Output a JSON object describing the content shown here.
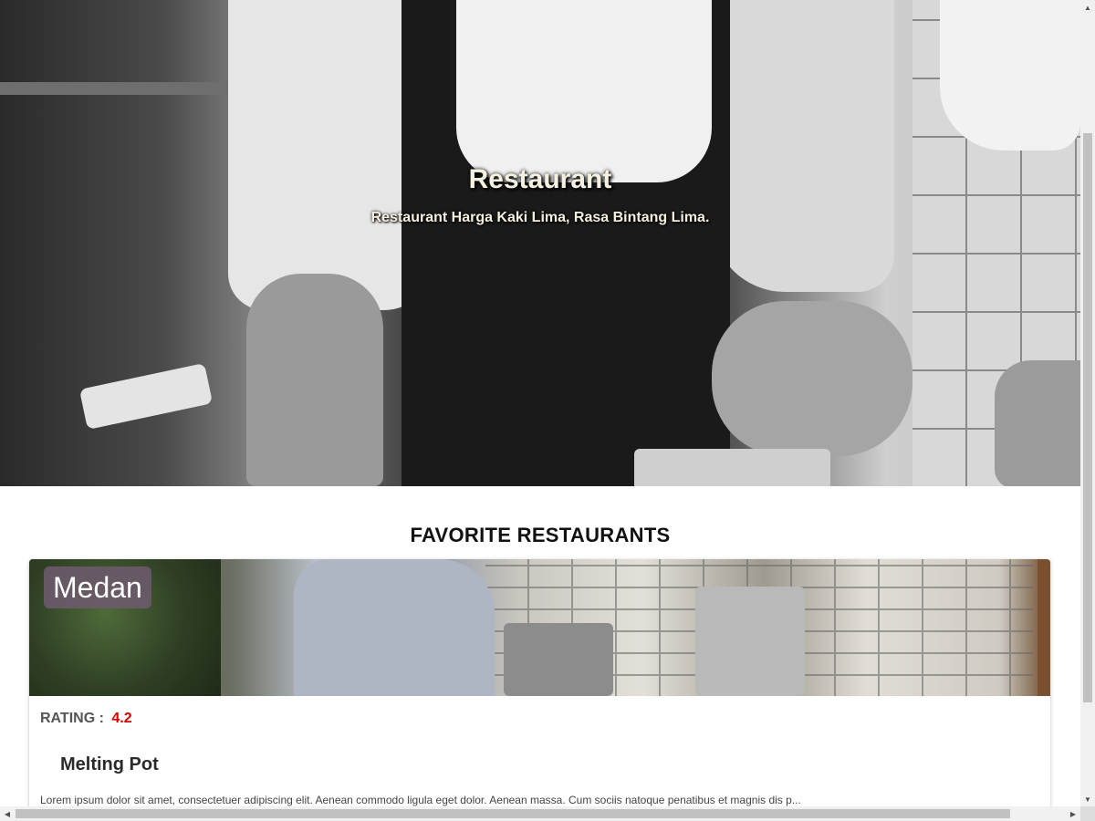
{
  "hero": {
    "title": "Restaurant",
    "subtitle": "Restaurant Harga Kaki Lima, Rasa Bintang Lima."
  },
  "section": {
    "title": "FAVORITE RESTAURANTS"
  },
  "restaurants": [
    {
      "city": "Medan",
      "rating_label": "RATING :",
      "rating_value": "4.2",
      "name": "Melting Pot",
      "description": "Lorem ipsum dolor sit amet, consectetuer adipiscing elit. Aenean commodo ligula eget dolor. Aenean massa. Cum sociis natoque penatibus et magnis dis p..."
    }
  ],
  "colors": {
    "city_badge": "#6e5a6e",
    "rating_value": "#d00000"
  },
  "icons": {
    "scroll_up": "arrow-up-icon",
    "scroll_down": "arrow-down-icon",
    "scroll_left": "arrow-left-icon",
    "scroll_right": "arrow-right-icon"
  }
}
